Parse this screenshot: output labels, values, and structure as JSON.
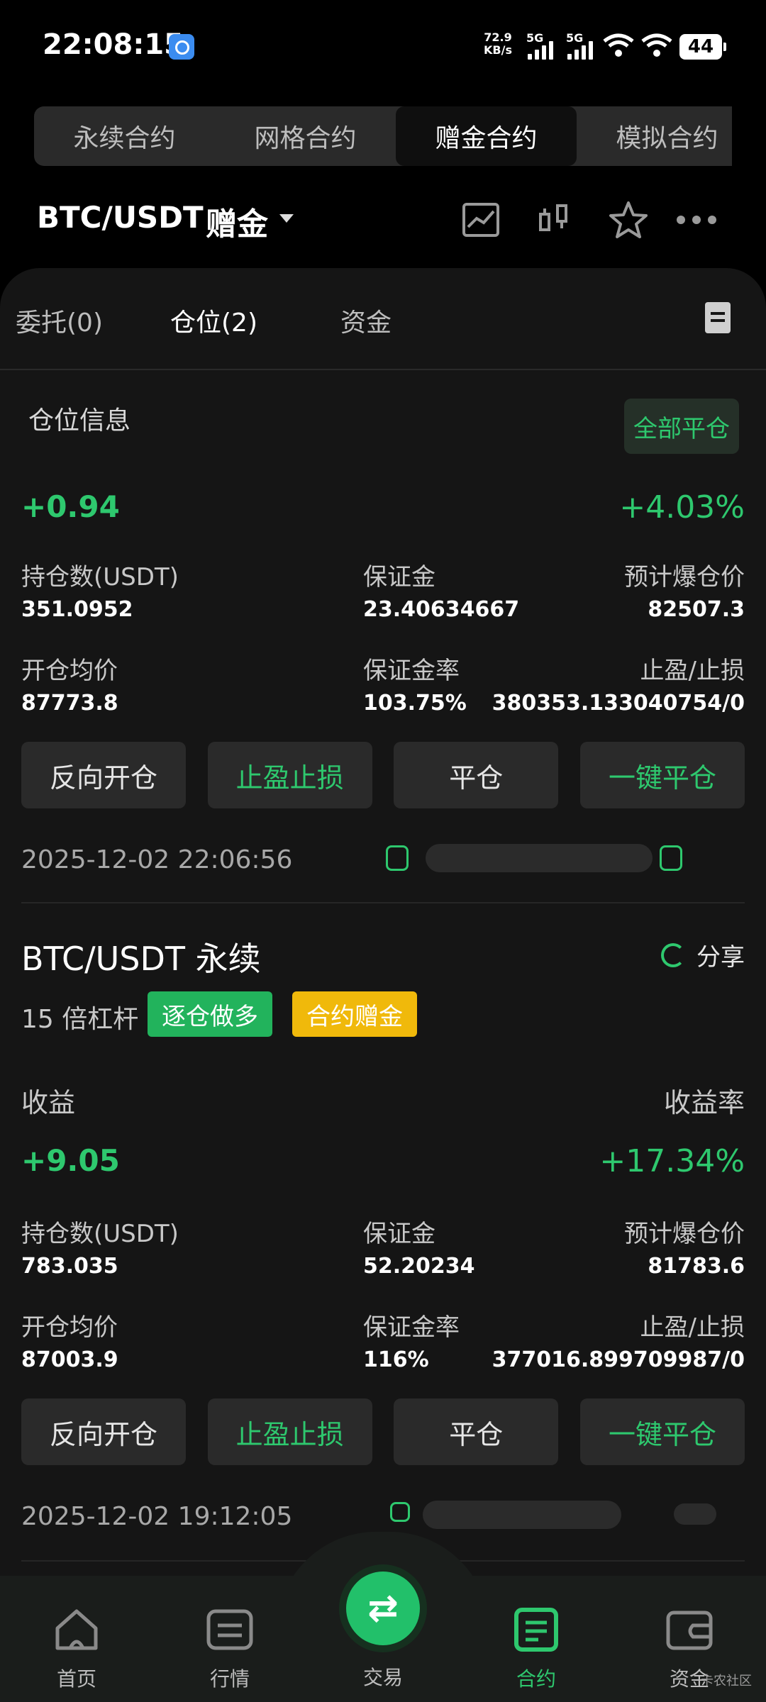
{
  "status_bar": {
    "time": "22:08:15",
    "net_speed": "72.9",
    "net_unit": "KB/s",
    "sim1": "5G",
    "sim2": "5G",
    "battery": "44"
  },
  "top_tabs": [
    {
      "label": "永续合约",
      "active": false
    },
    {
      "label": "网格合约",
      "active": false
    },
    {
      "label": "赠金合约",
      "active": true
    },
    {
      "label": "模拟合约",
      "active": false
    }
  ],
  "header": {
    "pair": "BTC/USDT",
    "tag": "赠金",
    "icons": [
      "chart-icon",
      "candlestick-icon",
      "star-icon",
      "more-icon"
    ]
  },
  "sub_tabs": [
    {
      "label": "委托(0)",
      "active": false
    },
    {
      "label": "仓位(2)",
      "active": true
    },
    {
      "label": "资金",
      "active": false
    }
  ],
  "section": {
    "title": "仓位信息",
    "close_all": "全部平仓"
  },
  "labels": {
    "holding": "持仓数(USDT)",
    "margin": "保证金",
    "liq_price": "预计爆仓价",
    "avg_price": "开仓均价",
    "margin_ratio": "保证金率",
    "tp_sl": "止盈/止损",
    "reverse": "反向开仓",
    "tpsl_btn": "止盈止损",
    "close": "平仓",
    "one_click_close": "一键平仓",
    "profit": "收益",
    "profit_rate": "收益率",
    "share": "分享"
  },
  "positions": [
    {
      "pnl": "+0.94",
      "pnl_pct": "+4.03%",
      "holding": "351.0952",
      "margin": "23.40634667",
      "liq_price": "82507.3",
      "avg_price": "87773.8",
      "margin_ratio": "103.75%",
      "tp_sl": "380353.133040754/0",
      "time": "2025-12-02 22:06:56"
    },
    {
      "title": "BTC/USDT 永续",
      "leverage": "15 倍杠杆",
      "badge_side": "逐仓做多",
      "badge_bonus": "合约赠金",
      "pnl": "+9.05",
      "pnl_pct": "+17.34%",
      "holding": "783.035",
      "margin": "52.20234",
      "liq_price": "81783.6",
      "avg_price": "87003.9",
      "margin_ratio": "116%",
      "tp_sl": "377016.899709987/0",
      "time": "2025-12-02 19:12:05"
    }
  ],
  "bottom_nav": [
    {
      "label": "首页",
      "icon": "home-icon"
    },
    {
      "label": "行情",
      "icon": "market-icon"
    },
    {
      "label": "交易",
      "icon": "swap-icon"
    },
    {
      "label": "合约",
      "icon": "contract-icon",
      "active": true
    },
    {
      "label": "资金",
      "icon": "wallet-icon"
    }
  ],
  "watermark": "卡农社区",
  "colors": {
    "accent_green": "#2ec86e",
    "bonus_yellow": "#f0b90b",
    "panel_bg": "#151515"
  }
}
